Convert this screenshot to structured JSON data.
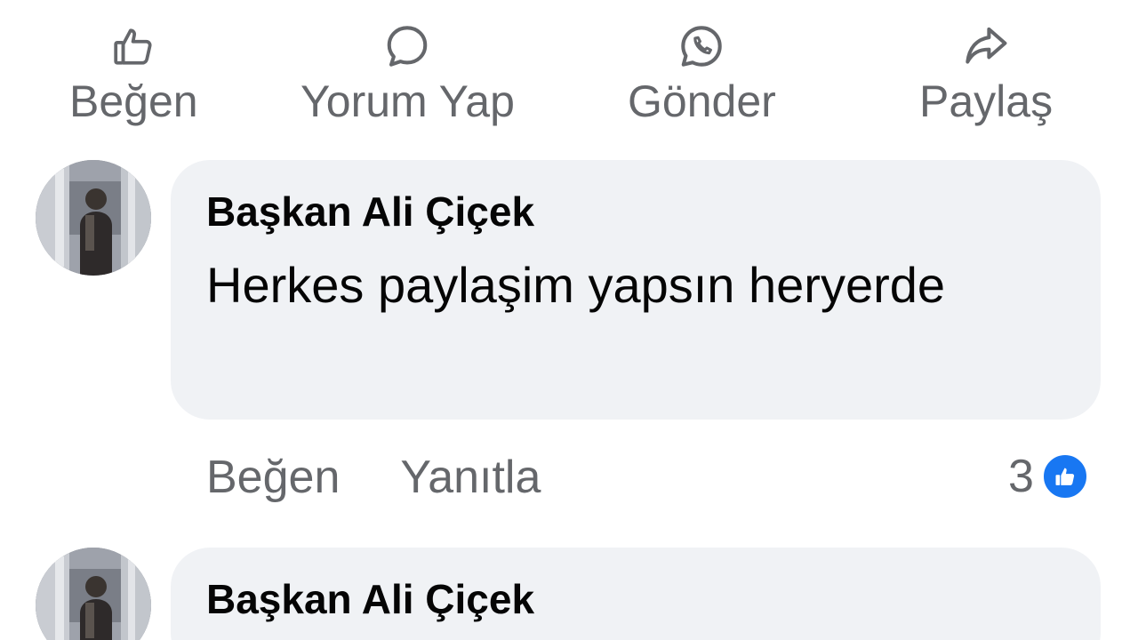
{
  "action_bar": {
    "like_label": "Beğen",
    "comment_label": "Yorum Yap",
    "send_label": "Gönder",
    "share_label": "Paylaş",
    "icons": {
      "like": "thumbs-up-icon",
      "comment": "comment-bubble-icon",
      "send": "whatsapp-icon",
      "share": "share-arrow-icon"
    }
  },
  "comments": [
    {
      "author": "Başkan Ali Çiçek",
      "text": "Herkes paylaşim yapsın heryerde",
      "like_label": "Beğen",
      "reply_label": "Yanıtla",
      "reaction_count": "3",
      "reaction_icon": "like-reaction-icon"
    },
    {
      "author": "Başkan Ali Çiçek"
    }
  ],
  "colors": {
    "text_primary": "#050505",
    "text_secondary": "#65676b",
    "bubble_bg": "#f0f2f5",
    "like_blue": "#1877f2"
  }
}
